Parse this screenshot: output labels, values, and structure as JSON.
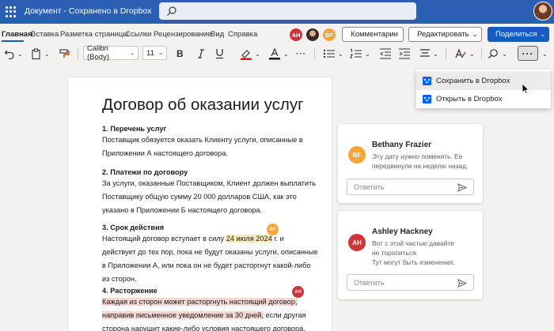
{
  "titlebar": {
    "title": "Документ - Сохранено в Dropbox"
  },
  "menu": {
    "items": [
      "Главная",
      "Вставка",
      "Разметка страницы",
      "Ссылки",
      "Рецензирование",
      "Вид",
      "Справка"
    ]
  },
  "collab": {
    "avatars": [
      {
        "initials": "AH",
        "color": "#d13438"
      },
      {
        "initials": "BF",
        "color": "#f7a43a"
      }
    ],
    "comments_label": "Комментарии",
    "edit_label": "Редактировать",
    "share_label": "Поделиться"
  },
  "ribbon": {
    "font": "Calibri (Body)",
    "size": "11"
  },
  "document": {
    "title": "Договор об оказании услуг",
    "sections": [
      {
        "heading": "1. Перечень услуг",
        "lines": [
          "Поставщик обязуется оказать Клиенту услуги, описанные в",
          "Приложении А настоящего договора."
        ]
      },
      {
        "heading": "2. Платежи по договору",
        "lines": [
          "За услуги, оказанные Поставщиком, Клиент должен выплатить",
          "Поставщику общую сумму 20 000 долларов США, как это",
          "указано в Приложении Б настоящего договора."
        ]
      },
      {
        "heading": "3. Срок действия",
        "line1_pre": "Настоящий договор вступает в силу ",
        "line1_hl": "24 июля 2024",
        "line1_post": " г. и",
        "lines": [
          "действует до тех пор, пока не будут оказаны услуги, описанные",
          "в Приложении А, или пока он не будет расторгнут какой-либо",
          "из сторон."
        ]
      },
      {
        "heading": "4. Расторжение",
        "hl_lines": [
          "Каждая из сторон может расторгнуть настоящий договор,",
          "направив письменное уведомление за 30 дней,"
        ],
        "hl_tail": " если другая",
        "lines": [
          "сторона нарушит какие-либо условия настоящего договора."
        ]
      }
    ],
    "badge_bf": "BF",
    "badge_ah": "AH"
  },
  "comments": [
    {
      "name": "Bethany Frazier",
      "initials": "BF",
      "color": "#f7a43a",
      "text": [
        "Эту дату нужно поменять. Ее",
        "передвинули на неделю назад."
      ],
      "reply_placeholder": "Ответить"
    },
    {
      "name": "Ashley Hackney",
      "initials": "AH",
      "color": "#d13438",
      "text": [
        "Вот с этой частью давайте",
        "не торопиться.",
        "Тут могут быть изменения."
      ],
      "reply_placeholder": "Ответить"
    }
  ],
  "dropdown": {
    "items": [
      "Сохранить в Dropbox",
      "Открыть в Dropbox"
    ]
  },
  "colors": {
    "brand": "#2b5fb3",
    "accent": "#185abd",
    "dropbox": "#0061fe"
  }
}
